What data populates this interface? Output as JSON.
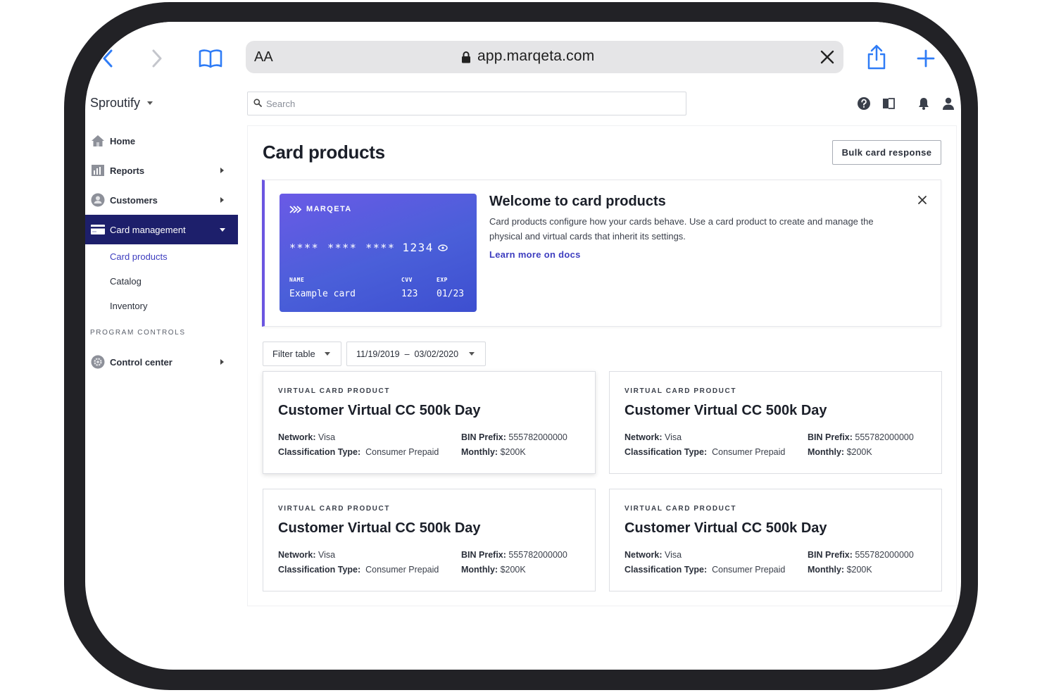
{
  "browser": {
    "url": "app.marqeta.com",
    "reader_label": "AA",
    "icons": [
      "back-icon",
      "forward-icon",
      "bookmarks-icon",
      "lock-icon",
      "clear-icon",
      "share-icon",
      "new-tab-icon"
    ]
  },
  "header": {
    "org_name": "Sproutify",
    "search_placeholder": "Search",
    "icons": [
      "help-icon",
      "docs-icon",
      "notifications-icon",
      "user-icon"
    ]
  },
  "sidebar": {
    "items": [
      {
        "label": "Home",
        "icon": "home-icon"
      },
      {
        "label": "Reports",
        "icon": "reports-icon"
      },
      {
        "label": "Customers",
        "icon": "customers-icon"
      },
      {
        "label": "Card management",
        "icon": "card-icon"
      }
    ],
    "card_management_sub": [
      "Card products",
      "Catalog",
      "Inventory"
    ],
    "section_label": "PROGRAM CONTROLS",
    "control_center": {
      "label": "Control center",
      "icon": "gear-icon"
    }
  },
  "main": {
    "title": "Card products",
    "bulk_button": "Bulk card response",
    "welcome": {
      "title": "Welcome to card products",
      "description": "Card products configure how your cards behave. Use a card product to create and manage the physical and virtual cards that inherit its settings.",
      "link": "Learn more on docs"
    },
    "card_visual": {
      "brand": "MARQETA",
      "masked_groups": [
        "****",
        "****",
        "****"
      ],
      "last4": "1234",
      "name_label": "NAME",
      "name_value": "Example card",
      "cvv_label": "CVV",
      "cvv_value": "123",
      "exp_label": "EXP",
      "exp_value": "01/23",
      "gradient": [
        "#6a5ae6",
        "#3d4fd0"
      ]
    },
    "filter_label": "Filter table",
    "date_range": "11/19/2019  –  03/02/2020",
    "products": [
      {
        "type": "VIRTUAL CARD PRODUCT",
        "name": "Customer Virtual CC 500k Day",
        "network_label": "Network:",
        "network": "Visa",
        "bin_label": "BIN Prefix:",
        "bin": "555782000000",
        "class_label": "Classification Type:",
        "classification": "Consumer Prepaid",
        "monthly_label": "Monthly:",
        "monthly": "$200K"
      },
      {
        "type": "VIRTUAL CARD PRODUCT",
        "name": "Customer Virtual CC 500k Day",
        "network_label": "Network:",
        "network": "Visa",
        "bin_label": "BIN Prefix:",
        "bin": "555782000000",
        "class_label": "Classification Type:",
        "classification": "Consumer Prepaid",
        "monthly_label": "Monthly:",
        "monthly": "$200K"
      },
      {
        "type": "VIRTUAL CARD PRODUCT",
        "name": "Customer Virtual CC 500k Day",
        "network_label": "Network:",
        "network": "Visa",
        "bin_label": "BIN Prefix:",
        "bin": "555782000000",
        "class_label": "Classification Type:",
        "classification": "Consumer Prepaid",
        "monthly_label": "Monthly:",
        "monthly": "$200K"
      },
      {
        "type": "VIRTUAL CARD PRODUCT",
        "name": "Customer Virtual CC 500k Day",
        "network_label": "Network:",
        "network": "Visa",
        "bin_label": "BIN Prefix:",
        "bin": "555782000000",
        "class_label": "Classification Type:",
        "classification": "Consumer Prepaid",
        "monthly_label": "Monthly:",
        "monthly": "$200K"
      }
    ]
  },
  "colors": {
    "accent": "#3d3dbf",
    "nav_active_bg": "#1d1f6b",
    "welcome_border": "#6b55e0",
    "ios_blue": "#2f7cf6"
  }
}
